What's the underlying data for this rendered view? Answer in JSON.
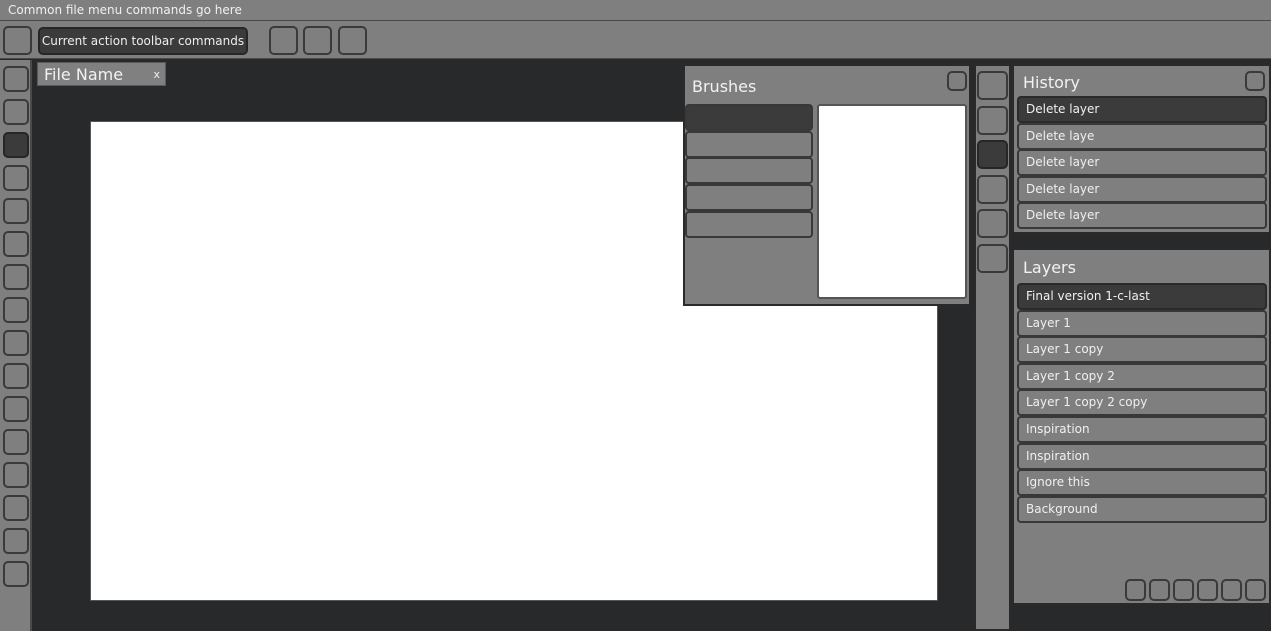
{
  "menubar": {
    "text": "Common file menu commands go here"
  },
  "toolbar": {
    "action_label": "Current action toolbar commands",
    "buttons": [
      "tool-option",
      "toolbar-button-1",
      "toolbar-button-2",
      "toolbar-button-3"
    ]
  },
  "left_tools": {
    "count": 16,
    "active_index": 2
  },
  "document": {
    "tab_name": "File Name",
    "close_label": "x"
  },
  "brushes": {
    "title": "Brushes",
    "presets": [
      "",
      "",
      "",
      "",
      ""
    ],
    "active_index": 0
  },
  "mid_tools": {
    "count": 6,
    "active_index": 2
  },
  "history": {
    "title": "History",
    "items": [
      "Delete layer",
      "Delete laye",
      "Delete layer",
      "Delete layer",
      "Delete layer"
    ],
    "active_index": 0
  },
  "layers": {
    "title": "Layers",
    "items": [
      "Final version 1-c-last",
      "Layer 1",
      "Layer 1 copy",
      "Layer 1 copy 2",
      "Layer 1 copy 2 copy",
      "Inspiration",
      "Inspiration",
      "Ignore this",
      "Background"
    ],
    "active_index": 0,
    "footer_button_count": 6
  }
}
